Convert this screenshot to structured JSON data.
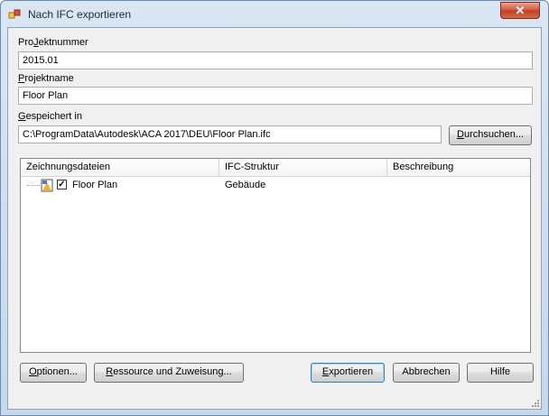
{
  "window": {
    "title": "Nach IFC exportieren",
    "close_label": "✕"
  },
  "form": {
    "projektnummer_label_u": "J",
    "projektnummer_label_a": "Pro",
    "projektnummer_label_b": "ektnummer",
    "projektnummer_value": "2015.01",
    "projektname_label_u": "P",
    "projektname_label_b": "rojektname",
    "projektname_value": "Floor Plan",
    "gespeichert_label_u": "G",
    "gespeichert_label_b": "espeichert in",
    "gespeichert_value": "C:\\ProgramData\\Autodesk\\ACA 2017\\DEU\\Floor Plan.ifc",
    "browse_u": "D",
    "browse_b": "urchsuchen..."
  },
  "list": {
    "columns": [
      "Zeichnungsdateien",
      "IFC-Struktur",
      "Beschreibung"
    ],
    "rows": [
      {
        "name": "Floor Plan",
        "structure": "Gebäude",
        "description": "",
        "checked": "✓"
      }
    ]
  },
  "buttons": {
    "optionen_u": "O",
    "optionen_b": "ptionen...",
    "ressource_u": "R",
    "ressource_b": "essource und Zuweisung...",
    "exportieren_u": "E",
    "exportieren_b": "xportieren",
    "abbrechen": "Abbrechen",
    "hilfe": "Hilfe"
  },
  "colors": {
    "accent": "#3c7fb1",
    "close": "#c13c22"
  }
}
